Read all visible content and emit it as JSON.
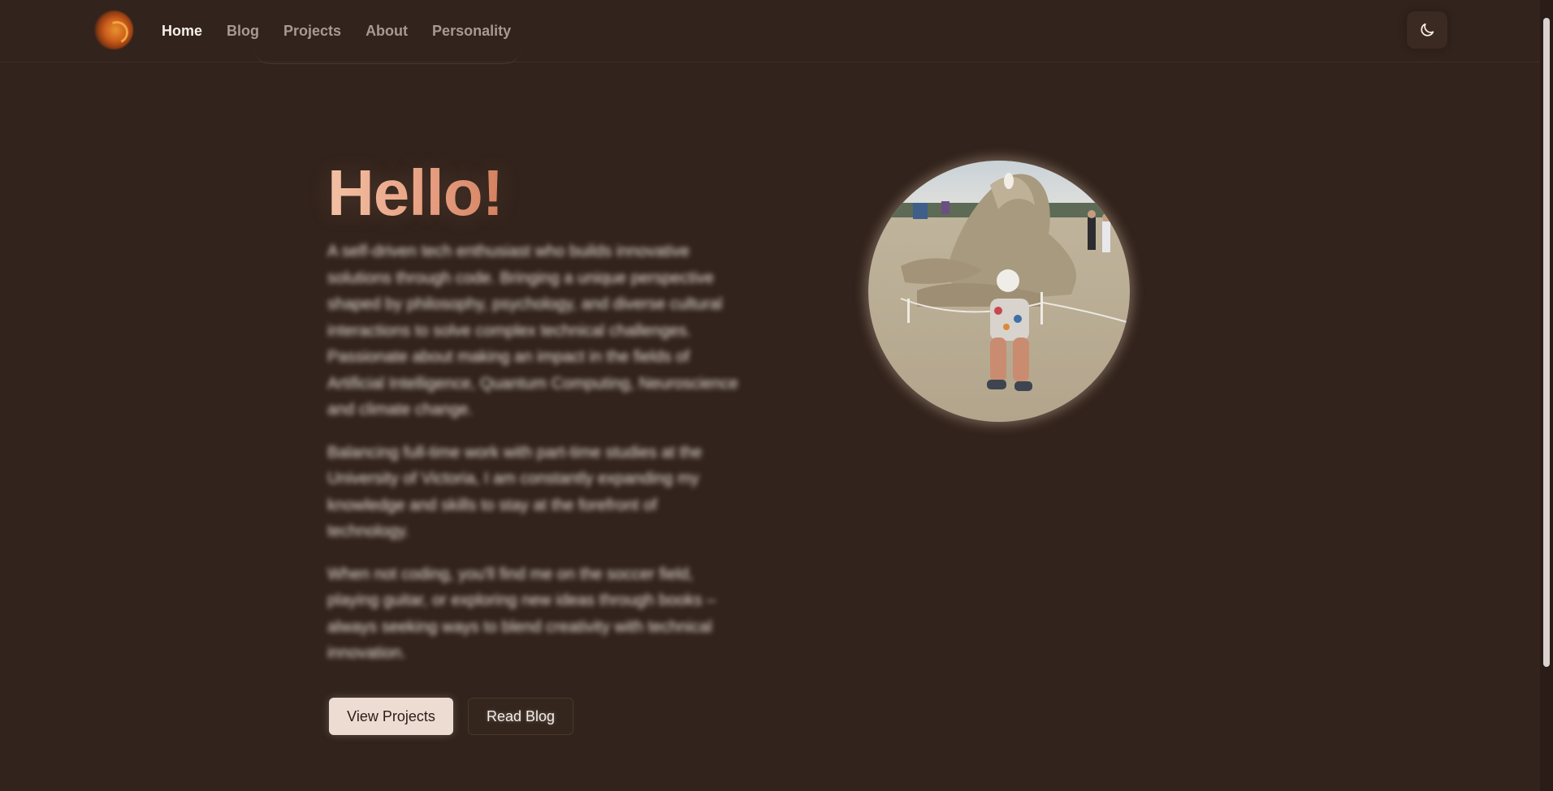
{
  "header": {
    "logo_icon": "swirl-logo-icon",
    "nav": [
      {
        "label": "Home",
        "active": true
      },
      {
        "label": "Blog",
        "active": false
      },
      {
        "label": "Projects",
        "active": false
      },
      {
        "label": "About",
        "active": false
      },
      {
        "label": "Personality",
        "active": false
      }
    ],
    "theme_toggle_icon": "moon-icon"
  },
  "hero": {
    "title": "Hello!",
    "paragraphs": [
      "A self-driven tech enthusiast who builds innovative solutions through code. Bringing a unique perspective shaped by philosophy, psychology, and diverse cultural interactions to solve complex technical challenges. Passionate about making an impact in the fields of Artificial Intelligence, Quantum Computing, Neuroscience and climate change.",
      "Balancing full-time work with part-time studies at the University of Victoria, I am constantly expanding my knowledge and skills to stay at the forefront of technology.",
      "When not coding, you'll find me on the soccer field, playing guitar, or exploring new ideas through books – always seeking ways to blend creativity with technical innovation."
    ],
    "buttons": {
      "primary": "View Projects",
      "secondary": "Read Blog"
    },
    "portrait_icon": "profile-photo"
  },
  "colors": {
    "background": "#32231c",
    "title_gradient_start": "#f4c2a6",
    "title_gradient_end": "#d3805f",
    "primary_button": "#ecdcd2"
  }
}
